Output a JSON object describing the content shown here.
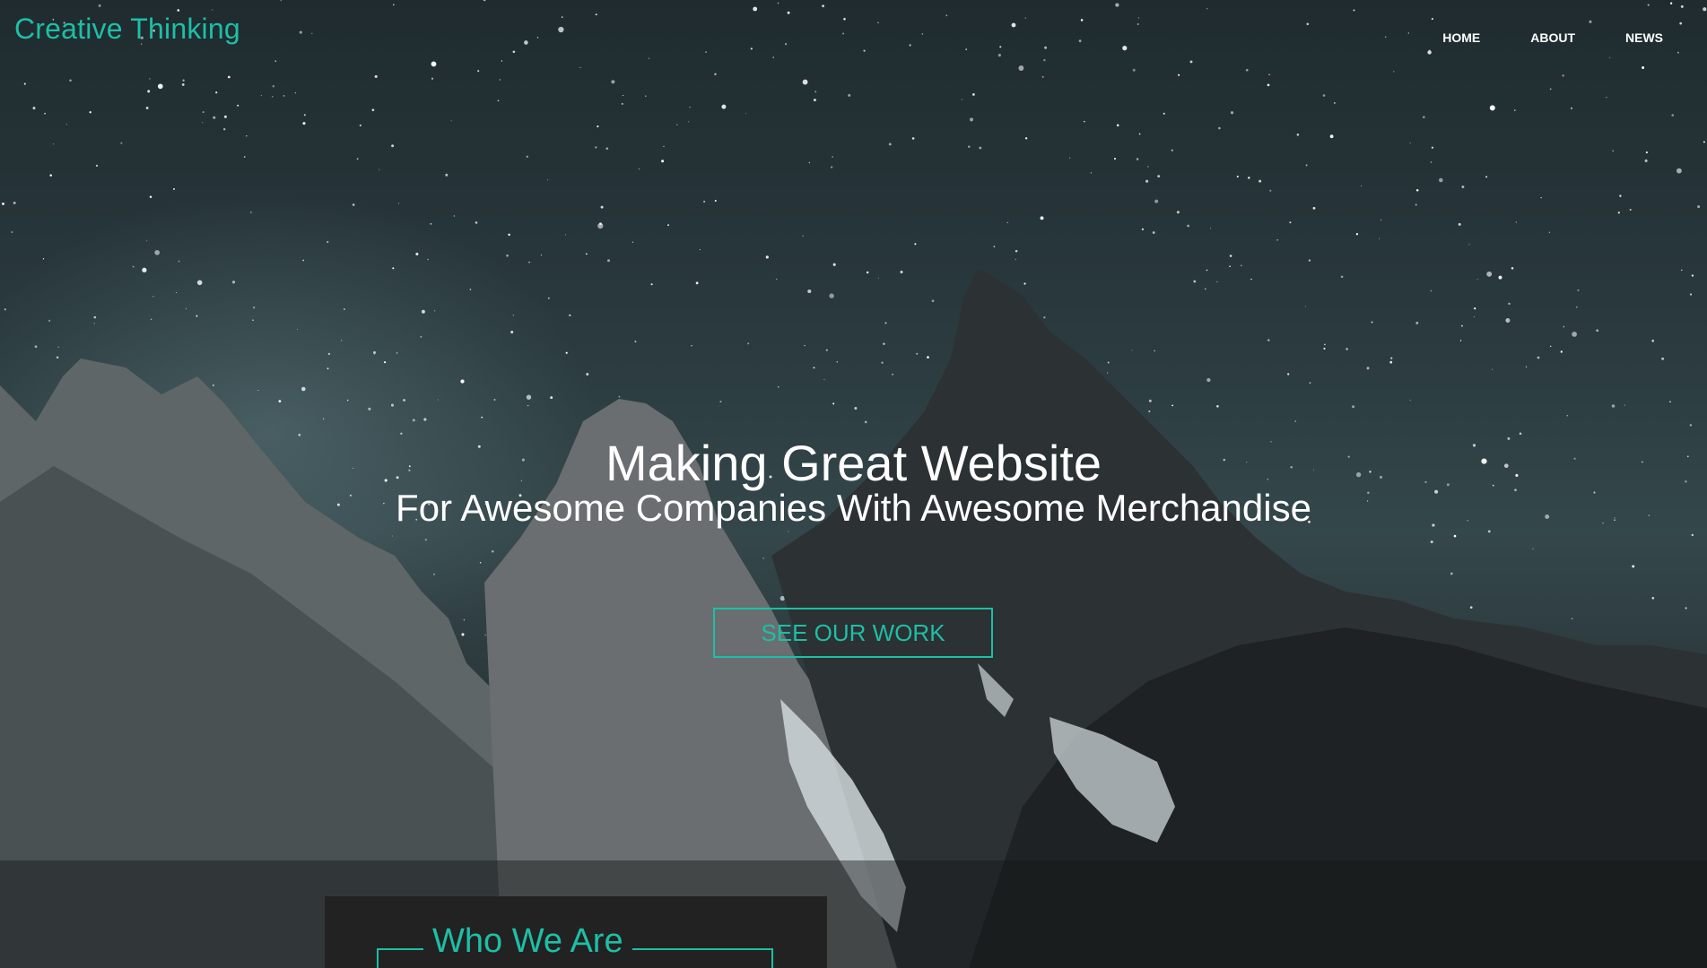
{
  "site": {
    "logo": "Creative Thinking"
  },
  "nav": {
    "items": [
      "HOME",
      "ABOUT",
      "NEWS"
    ]
  },
  "hero": {
    "headline": "Making Great Website",
    "subheadline": "For Awesome Companies With Awesome Merchandise",
    "cta_label": "SEE OUR WORK"
  },
  "about": {
    "title": "Who We Are"
  },
  "colors": {
    "accent": "#1dbfa6",
    "text": "#ffffff",
    "panel": "#222222"
  }
}
